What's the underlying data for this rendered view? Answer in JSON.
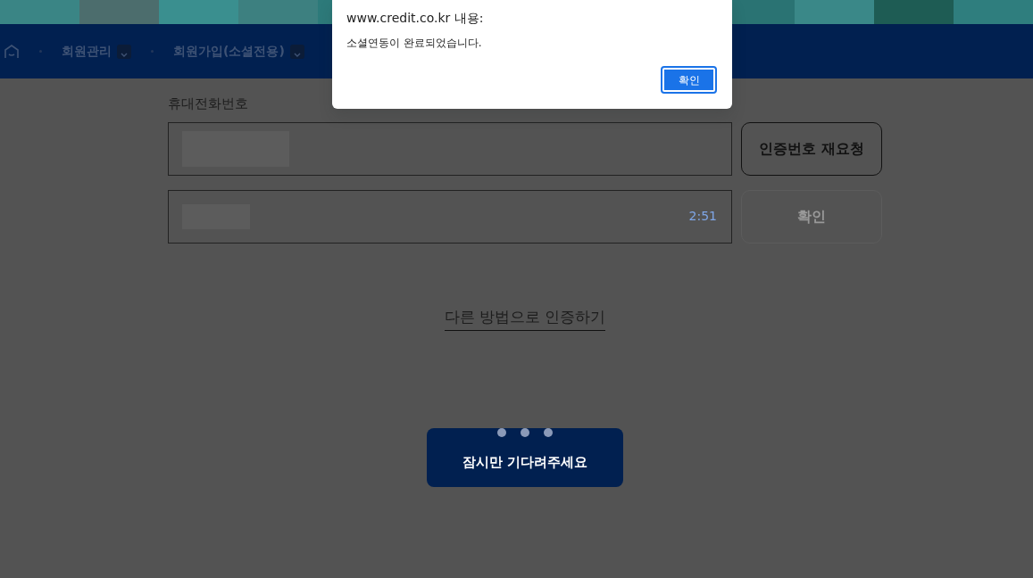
{
  "nav": {
    "items": [
      {
        "label": "회원관리",
        "has_dropdown": true
      },
      {
        "label": "회원가입(소셜전용)",
        "has_dropdown": true
      }
    ]
  },
  "form": {
    "phone_label": "휴대전화번호",
    "fields": [
      {
        "masked": true,
        "button": {
          "label": "인증번호 재요청",
          "disabled": false
        }
      },
      {
        "masked": true,
        "timer": "2:51",
        "button": {
          "label": "확인",
          "disabled": true
        }
      }
    ],
    "alt_link": "다른 방법으로 인증하기"
  },
  "loading": {
    "message": "잠시만 기다려주세요"
  },
  "dialog": {
    "title": "www.credit.co.kr 내용:",
    "message": "소셜연동이 완료되었습니다.",
    "button": "확인"
  }
}
